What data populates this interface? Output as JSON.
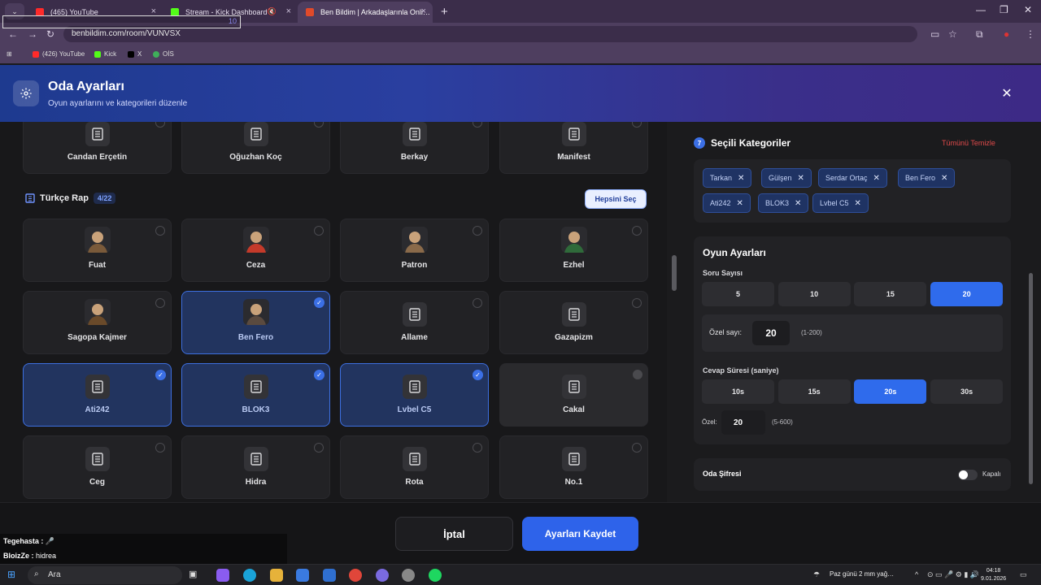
{
  "browser": {
    "tabs": [
      {
        "label": "(465) YouTube",
        "active": false,
        "favicon_color": "#ff2a2a"
      },
      {
        "label": "Stream - Kick Dashboard",
        "active": false,
        "favicon_color": "#53fc18"
      },
      {
        "label": "Ben Bildim | Arkadaşlarınla Onli…",
        "active": true,
        "favicon_color": "#e04a2a"
      }
    ],
    "url": "benbildim.com/room/VUNVSX",
    "overlay_number": "10",
    "bookmarks": [
      {
        "label": "(426) YouTube",
        "color": "#ff2a2a"
      },
      {
        "label": "Kick",
        "color": "#53fc18"
      },
      {
        "label": "X",
        "color": "#000000"
      },
      {
        "label": "OİS",
        "color": "#3fae5a"
      }
    ]
  },
  "modal": {
    "title": "Oda Ayarları",
    "subtitle": "Oyun ayarlarını ve kategorileri düzenle"
  },
  "top_row": [
    {
      "name": "Candan Erçetin"
    },
    {
      "name": "Oğuzhan Koç"
    },
    {
      "name": "Berkay"
    },
    {
      "name": "Manifest"
    }
  ],
  "section": {
    "title": "Türkçe Rap",
    "count": "4/22",
    "select_all": "Hepsini Seç"
  },
  "artists": [
    {
      "name": "Fuat",
      "state": "avatar",
      "avatar_color": "#7a5a3a"
    },
    {
      "name": "Ceza",
      "state": "avatar",
      "avatar_color": "#c43a2a"
    },
    {
      "name": "Patron",
      "state": "avatar",
      "avatar_color": "#8a6a4a"
    },
    {
      "name": "Ezhel",
      "state": "avatar",
      "avatar_color": "#2f6a3a"
    },
    {
      "name": "Sagopa Kajmer",
      "state": "avatar",
      "avatar_color": "#6a4a2a"
    },
    {
      "name": "Ben Fero",
      "state": "selected-avatar",
      "avatar_color": "#5a4a3f"
    },
    {
      "name": "Allame",
      "state": "icon"
    },
    {
      "name": "Gazapizm",
      "state": "icon"
    },
    {
      "name": "Ati242",
      "state": "selected"
    },
    {
      "name": "BLOK3",
      "state": "selected"
    },
    {
      "name": "Lvbel C5",
      "state": "selected"
    },
    {
      "name": "Cakal",
      "state": "hover"
    },
    {
      "name": "Ceg",
      "state": "icon"
    },
    {
      "name": "Hidra",
      "state": "icon"
    },
    {
      "name": "Rota",
      "state": "icon"
    },
    {
      "name": "No.1",
      "state": "icon"
    }
  ],
  "selected_panel": {
    "count": "7",
    "title": "Seçili Kategoriler",
    "clear": "Tümünü Temizle",
    "tags": [
      "Tarkan",
      "Gülşen",
      "Serdar Ortaç",
      "Ben Fero",
      "Ati242",
      "BLOK3",
      "Lvbel C5"
    ]
  },
  "game_settings": {
    "title": "Oyun Ayarları",
    "question_label": "Soru Sayısı",
    "question_options": [
      "5",
      "10",
      "15",
      "20"
    ],
    "question_selected": "20",
    "custom_q_label": "Özel sayı:",
    "custom_q_value": "20",
    "custom_q_range": "(1-200)",
    "time_label": "Cevap Süresi (saniye)",
    "time_options": [
      "10s",
      "15s",
      "20s",
      "30s"
    ],
    "time_selected": "20s",
    "custom_t_label": "Özel:",
    "custom_t_value": "20",
    "custom_t_range": "(5-600)"
  },
  "password": {
    "label": "Oda Şifresi",
    "state": "Kapalı"
  },
  "footer": {
    "cancel": "İptal",
    "save": "Ayarları Kaydet"
  },
  "chat": [
    {
      "user": "Tegehasta :",
      "msg": "🎤"
    },
    {
      "user": "BloizZe :",
      "msg": "hidrea"
    }
  ],
  "taskbar": {
    "search": "Ara",
    "weather": "Paz günü 2 mm yağ…",
    "time": "04:18",
    "date": "9.01.2026"
  }
}
